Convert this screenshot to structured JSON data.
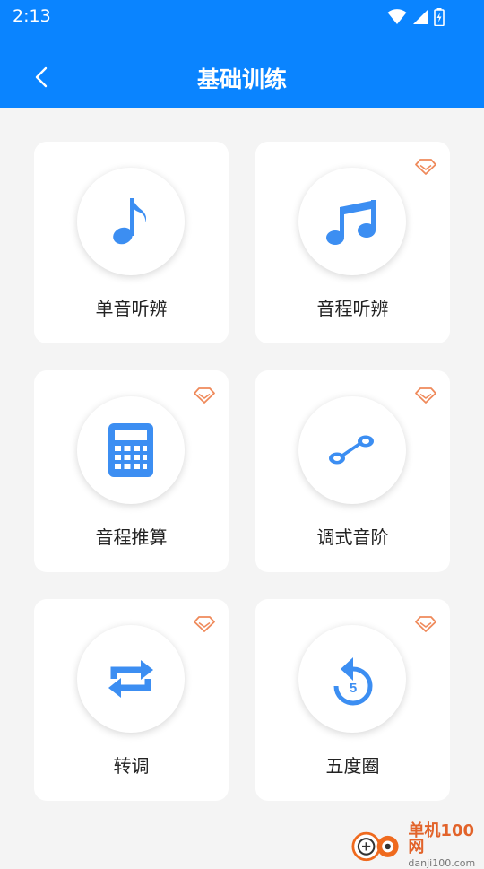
{
  "status_bar": {
    "time": "2:13"
  },
  "header": {
    "title": "基础训练"
  },
  "cards": [
    {
      "label": "单音听辨",
      "icon": "music-note-icon",
      "premium": false
    },
    {
      "label": "音程听辨",
      "icon": "music-notes-icon",
      "premium": true
    },
    {
      "label": "音程推算",
      "icon": "calculator-icon",
      "premium": true
    },
    {
      "label": "调式音阶",
      "icon": "scale-link-icon",
      "premium": true
    },
    {
      "label": "转调",
      "icon": "repeat-icon",
      "premium": true
    },
    {
      "label": "五度圈",
      "icon": "replay-5-icon",
      "premium": true
    }
  ],
  "watermark": {
    "name": "单机100网",
    "url": "danji100.com"
  },
  "colors": {
    "primary": "#0a84ff",
    "icon": "#3c8ef2",
    "premium": "#ef8a5b",
    "background": "#f4f4f4"
  }
}
